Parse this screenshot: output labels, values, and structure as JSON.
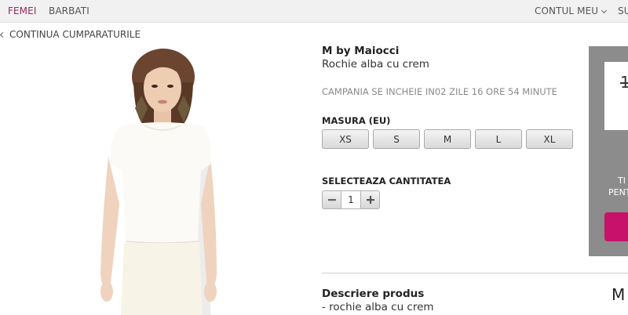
{
  "topnav": {
    "women": "FEMEI",
    "men": "BARBATI",
    "account": "CONTUL MEU",
    "support": "SU"
  },
  "back_link": "CONTINUA CUMPARATURILE",
  "product": {
    "brand": "M by Maiocci",
    "name": "Rochie alba cu crem",
    "campaign": "CAMPANIA SE INCHEIE IN02 ZILE 16 ORE 54 MINUTE"
  },
  "size": {
    "label": "MASURA (EU)",
    "options": [
      "XS",
      "S",
      "M",
      "L",
      "XL"
    ]
  },
  "quantity": {
    "label": "SELECTEAZA CANTITATEA",
    "value": "1"
  },
  "description": {
    "title": "Descriere produs",
    "text": "- rochie alba cu crem",
    "right_fragment": "M"
  },
  "price_panel": {
    "old_price_fragment": "1",
    "line1_fragment": "TI",
    "line2_fragment": "PENT"
  },
  "colors": {
    "accent": "#9b2660",
    "button": "#c8116a",
    "panel": "#8c8c8c"
  }
}
